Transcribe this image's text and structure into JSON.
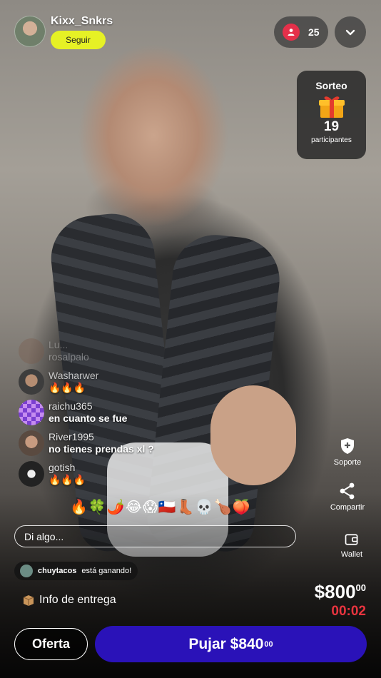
{
  "header": {
    "username": "Kixx_Snkrs",
    "follow_label": "Seguir",
    "viewer_count": "25"
  },
  "raffle": {
    "title": "Sorteo",
    "count": "19",
    "label": "participantes"
  },
  "chat": [
    {
      "name": "Lu...",
      "message": "rosalpalo"
    },
    {
      "name": "Washarwer",
      "message": "🔥🔥🔥"
    },
    {
      "name": "raichu365",
      "message": "en cuanto se fue"
    },
    {
      "name": "River1995",
      "message": "no tienes prendas xl ?"
    },
    {
      "name": "gotish",
      "message": "🔥🔥🔥"
    }
  ],
  "reactions": "🔥🍀🌶️😂😱🇨🇱👢💀🍗🍑",
  "input": {
    "placeholder": "Di algo..."
  },
  "winner": {
    "name": "chuytacos",
    "text": "está ganando!"
  },
  "delivery": {
    "label": "Info de entrega"
  },
  "side_actions": {
    "support": "Soporte",
    "share": "Compartir",
    "wallet": "Wallet"
  },
  "price": {
    "main": "$800",
    "cents": "00",
    "timer": "00:02"
  },
  "buttons": {
    "offer": "Oferta",
    "bid_main": "Pujar $840",
    "bid_cents": "00"
  },
  "colors": {
    "accent_follow": "#e6f125",
    "bid_button": "#2a12b8",
    "timer": "#e8343f",
    "viewer_badge": "#e5304a"
  },
  "icons": {
    "viewers": "person-icon",
    "collapse": "chevron-down-icon",
    "raffle": "gift-icon",
    "support": "shield-plus-icon",
    "share": "share-icon",
    "wallet": "wallet-icon",
    "delivery": "package-icon"
  }
}
